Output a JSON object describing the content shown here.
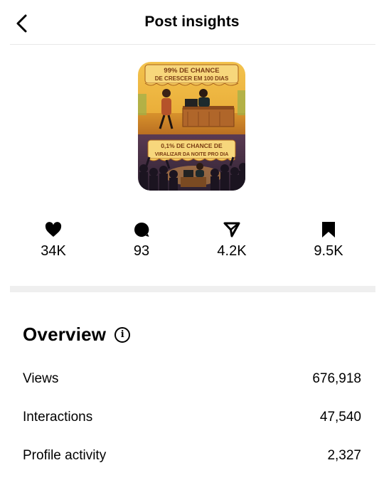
{
  "header": {
    "title": "Post insights",
    "back_icon": "chevron-left-icon"
  },
  "thumbnail": {
    "top_text_line1": "99% DE CHANCE",
    "top_text_line2": "DE CRESCER EM 100 DIAS",
    "bottom_text_line1": "0,1% DE CHANCE DE",
    "bottom_text_line2": "VIRALIZAR DA NOITE PRO DIA"
  },
  "stats": [
    {
      "icon": "heart-icon",
      "value": "34K"
    },
    {
      "icon": "comment-icon",
      "value": "93"
    },
    {
      "icon": "send-icon",
      "value": "4.2K"
    },
    {
      "icon": "bookmark-icon",
      "value": "9.5K"
    }
  ],
  "overview": {
    "title": "Overview",
    "info_icon": "info-icon",
    "rows": [
      {
        "label": "Views",
        "value": "676,918"
      },
      {
        "label": "Interactions",
        "value": "47,540"
      },
      {
        "label": "Profile activity",
        "value": "2,327"
      }
    ]
  }
}
